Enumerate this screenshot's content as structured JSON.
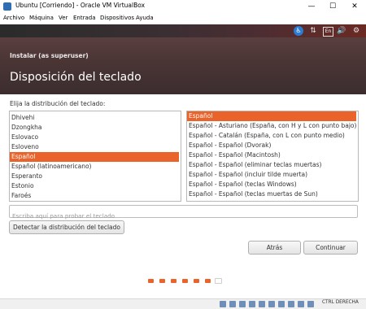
{
  "window": {
    "title": "Ubuntu [Corriendo] - Oracle VM VirtualBox",
    "minimize": "—",
    "maximize": "☐",
    "close": "✕"
  },
  "menu": [
    "Archivo",
    "Máquina",
    "Ver",
    "Entrada",
    "Dispositivos",
    "Ayuda"
  ],
  "tray": {
    "lang": "En"
  },
  "dialog": {
    "title": "Instalar (as superuser)",
    "heading": "Disposición del teclado",
    "prompt": "Elija la distribución del teclado:"
  },
  "layouts": [
    "Dhivehi",
    "Dzongkha",
    "Eslovaco",
    "Esloveno",
    "Español",
    "Español (latinoamericano)",
    "Esperanto",
    "Estonio",
    "Faroés"
  ],
  "variants": [
    "Español",
    "Español - Asturiano (España, con H y L con punto bajo)",
    "Español - Catalán (España, con L con punto medio)",
    "Español - Español (Dvorak)",
    "Español - Español (Macintosh)",
    "Español - Español (eliminar teclas muertas)",
    "Español - Español (incluir tilde muerta)",
    "Español - Español (teclas Windows)",
    "Español - Español (teclas muertas de Sun)"
  ],
  "selected": {
    "layout": "Español",
    "variant": "Español"
  },
  "test_input": {
    "placeholder": "Escriba aquí para probar el teclado",
    "value": ""
  },
  "buttons": {
    "detect": "Detectar la distribución del teclado",
    "back": "Atrás",
    "continue": "Continuar"
  },
  "progress": {
    "total_steps": 7,
    "current_step": 7
  },
  "statusbar": {
    "host_key": "CTRL DERECHA"
  },
  "colors": {
    "accent": "#e9632b",
    "header_bg": "#4b3535",
    "topbar_bg": "#2b2b2b"
  }
}
